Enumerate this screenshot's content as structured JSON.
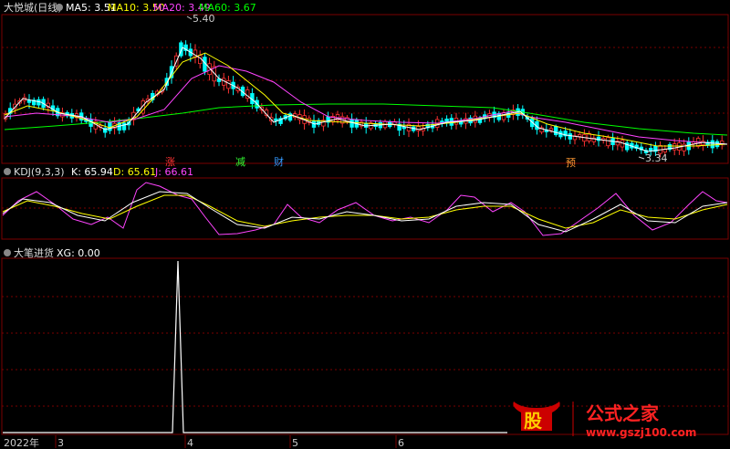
{
  "chart_data": [
    {
      "type": "candlestick",
      "title": "大悦城(日线)",
      "indicators": [
        {
          "name": "MA5",
          "value": "3.51",
          "color": "#ffffff"
        },
        {
          "name": "MA10",
          "value": "3.50",
          "color": "#ffff00"
        },
        {
          "name": "MA20",
          "value": "3.49",
          "color": "#ff44ff"
        },
        {
          "name": "MA60",
          "value": "3.67",
          "color": "#00ff00"
        }
      ],
      "price_high_label": "5.40",
      "price_low_label": "3.34",
      "markers": [
        {
          "text": "涨",
          "color": "#ff3333"
        },
        {
          "text": "减",
          "color": "#33ff33"
        },
        {
          "text": "财",
          "color": "#3399ff"
        },
        {
          "text": "预",
          "color": "#ff9933"
        }
      ]
    },
    {
      "type": "line",
      "title": "KDJ(9,3,3)",
      "indicators": [
        {
          "name": "K",
          "value": "65.94",
          "color": "#ffffff"
        },
        {
          "name": "D",
          "value": "65.61",
          "color": "#ffff00"
        },
        {
          "name": "J",
          "value": "66.61",
          "color": "#ff44ff"
        }
      ]
    },
    {
      "type": "line",
      "title": "大笔进货",
      "indicators": [
        {
          "name": "XG",
          "value": "0.00",
          "color": "#ffffff"
        }
      ]
    }
  ],
  "x_axis": {
    "labels": [
      "2022年",
      "3",
      "4",
      "5",
      "6"
    ]
  },
  "colors": {
    "up": "#ff3333",
    "down": "#00ffff",
    "grid": "#7a0000"
  },
  "watermark": {
    "logo_char": "股",
    "site_name": "公式之家",
    "url": "www.gszj100.com"
  }
}
